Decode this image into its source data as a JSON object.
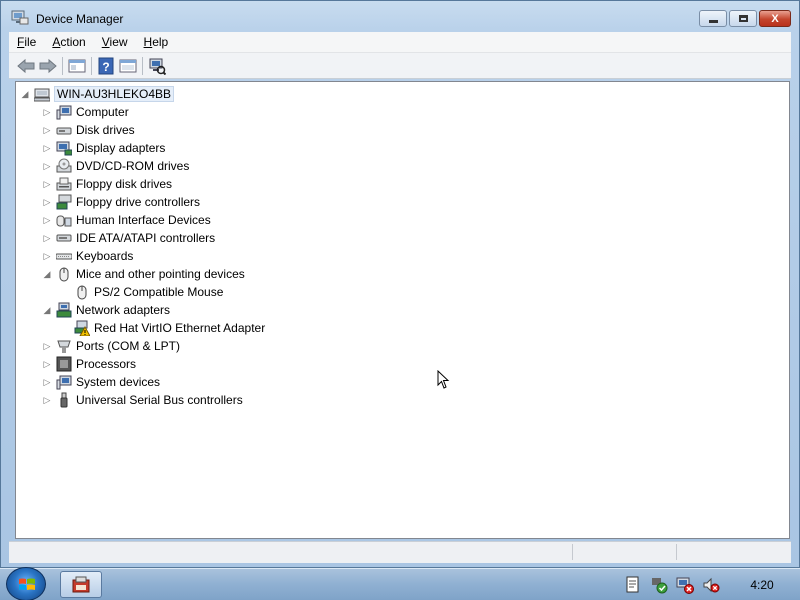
{
  "window": {
    "title": "Device Manager",
    "close_glyph": "X"
  },
  "menu": [
    {
      "key": "F",
      "rest": "ile"
    },
    {
      "key": "A",
      "rest": "ction"
    },
    {
      "key": "V",
      "rest": "iew"
    },
    {
      "key": "H",
      "rest": "elp"
    }
  ],
  "toolbar": {
    "buttons": [
      "back-arrow-icon",
      "forward-arrow-icon",
      "properties-icon",
      "help-icon",
      "show-hide-tree-icon",
      "scan-hardware-icon"
    ]
  },
  "tree": {
    "root": "WIN-AU3HLEKO4BB",
    "categories": [
      {
        "label": "Computer",
        "icon": "computer-icon",
        "expanded": false
      },
      {
        "label": "Disk drives",
        "icon": "disk-drive-icon",
        "expanded": false
      },
      {
        "label": "Display adapters",
        "icon": "display-adapter-icon",
        "expanded": false
      },
      {
        "label": "DVD/CD-ROM drives",
        "icon": "dvd-drive-icon",
        "expanded": false
      },
      {
        "label": "Floppy disk drives",
        "icon": "floppy-drive-icon",
        "expanded": false
      },
      {
        "label": "Floppy drive controllers",
        "icon": "floppy-controller-icon",
        "expanded": false
      },
      {
        "label": "Human Interface Devices",
        "icon": "hid-icon",
        "expanded": false
      },
      {
        "label": "IDE ATA/ATAPI controllers",
        "icon": "ide-controller-icon",
        "expanded": false
      },
      {
        "label": "Keyboards",
        "icon": "keyboard-icon",
        "expanded": false
      },
      {
        "label": "Mice and other pointing devices",
        "icon": "mouse-icon",
        "expanded": true,
        "children": [
          {
            "label": "PS/2 Compatible Mouse",
            "icon": "mouse-icon"
          }
        ]
      },
      {
        "label": "Network adapters",
        "icon": "network-adapter-icon",
        "expanded": true,
        "children": [
          {
            "label": "Red Hat VirtIO Ethernet Adapter",
            "icon": "network-adapter-warning-icon"
          }
        ]
      },
      {
        "label": "Ports (COM & LPT)",
        "icon": "port-icon",
        "expanded": false
      },
      {
        "label": "Processors",
        "icon": "processor-icon",
        "expanded": false
      },
      {
        "label": "System devices",
        "icon": "system-device-icon",
        "expanded": false
      },
      {
        "label": "Universal Serial Bus controllers",
        "icon": "usb-icon",
        "expanded": false
      }
    ]
  },
  "taskbar": {
    "clock": "4:20",
    "tray_icons": [
      "action-center-icon",
      "safely-remove-icon",
      "network-icon",
      "volume-muted-icon"
    ]
  },
  "colors": {
    "accent": "#2a74c4",
    "warning": "#f2c200",
    "close_button": "#c4452d"
  }
}
